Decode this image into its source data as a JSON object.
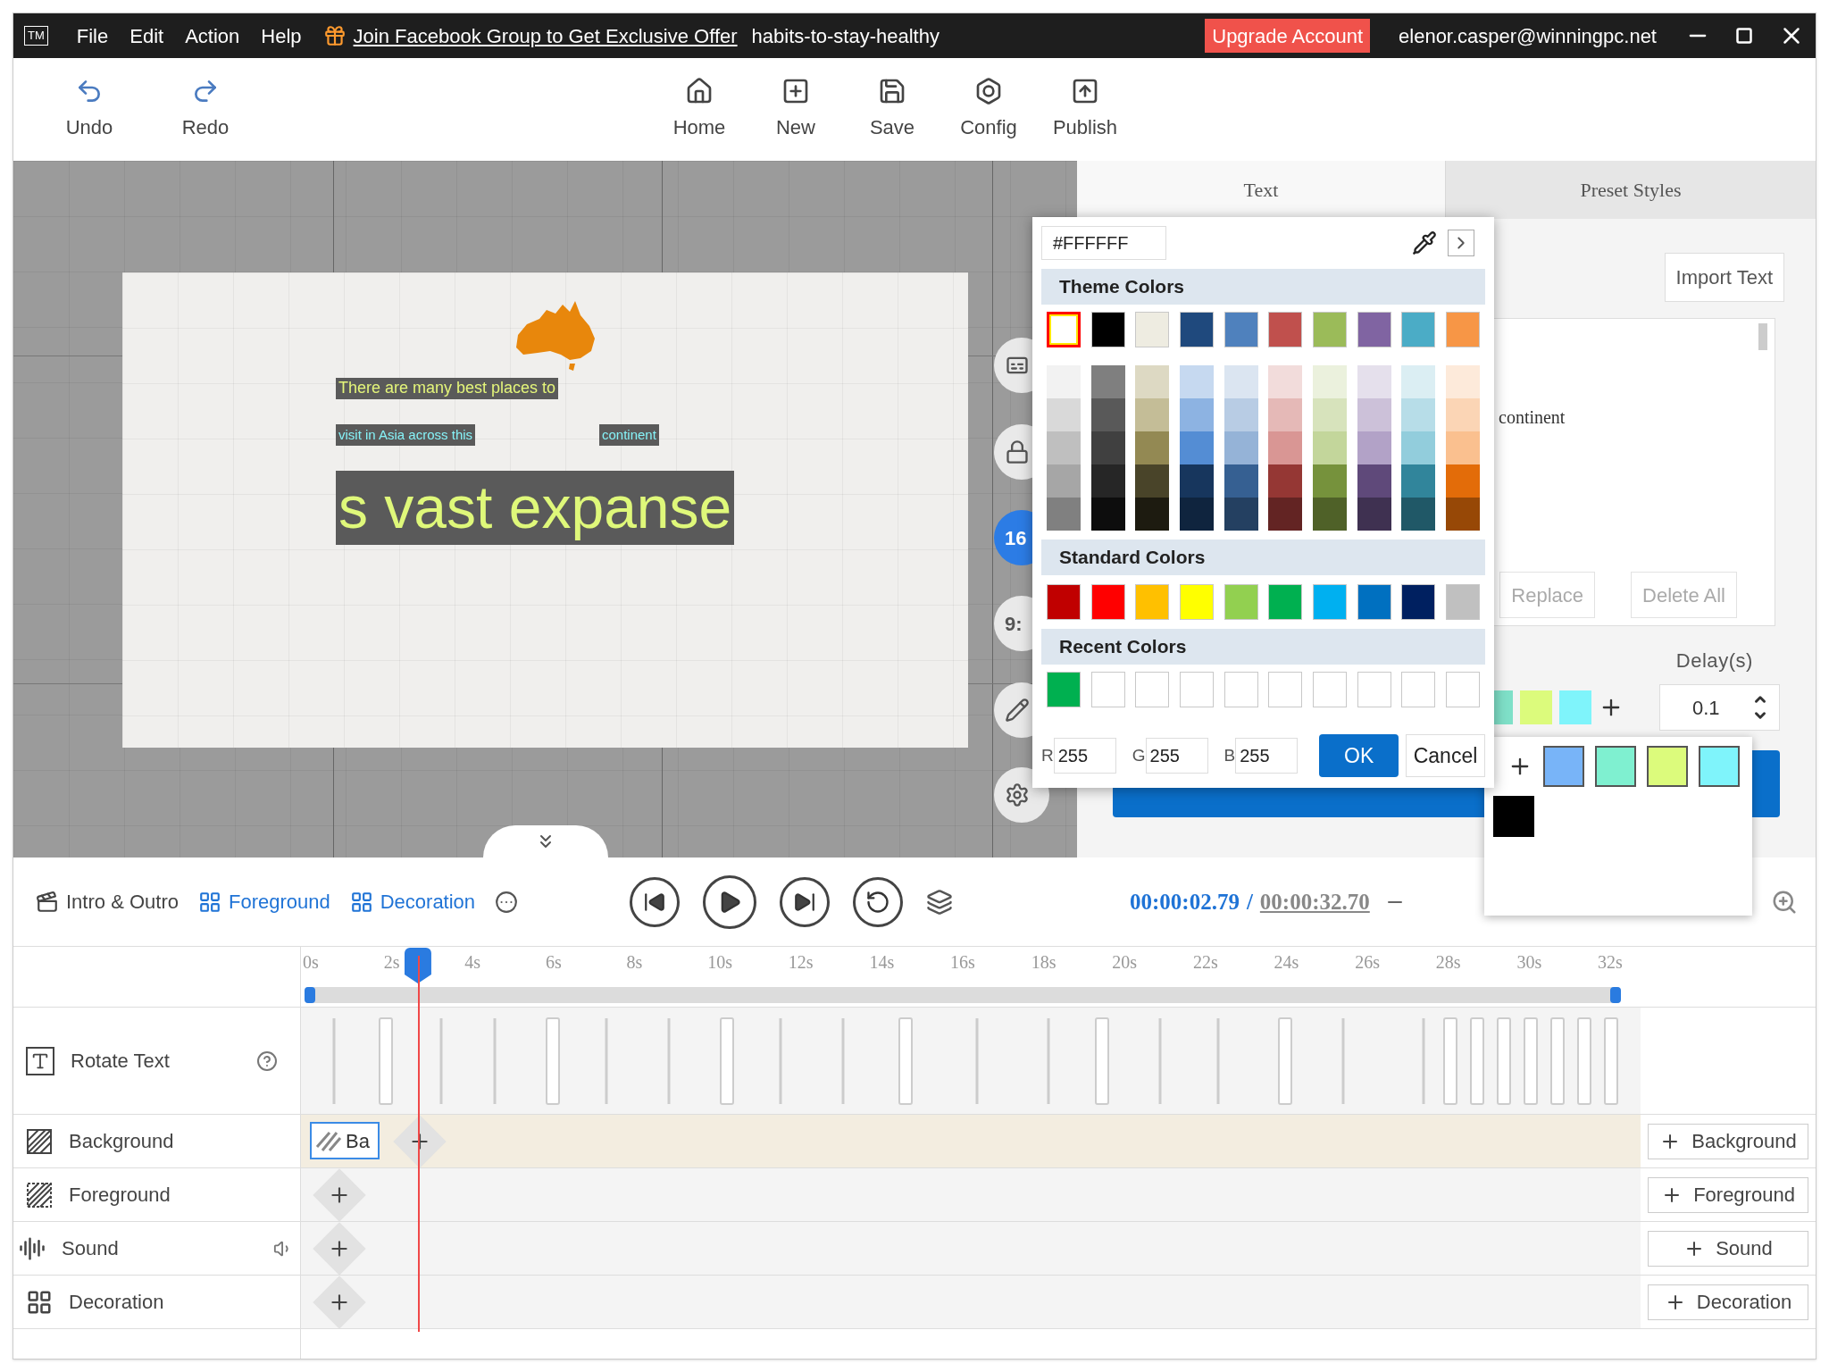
{
  "window": {
    "logo": "TM",
    "menu": [
      "File",
      "Edit",
      "Action",
      "Help"
    ],
    "promo_link": "Join Facebook Group to Get Exclusive Offer",
    "title": "habits-to-stay-healthy",
    "upgrade_button": "Upgrade Account",
    "user_email": "elenor.casper@winningpc.net"
  },
  "toolbar": {
    "left": [
      {
        "kind": "undo",
        "label": "Undo"
      },
      {
        "kind": "redo",
        "label": "Redo"
      }
    ],
    "center": [
      {
        "kind": "home",
        "label": "Home"
      },
      {
        "kind": "new",
        "label": "New"
      },
      {
        "kind": "save",
        "label": "Save"
      },
      {
        "kind": "config",
        "label": "Config"
      },
      {
        "kind": "publish",
        "label": "Publish"
      }
    ]
  },
  "canvas": {
    "texts": [
      {
        "text": "There are many best places to",
        "color": "#e4f57a"
      },
      {
        "text": "visit in Asia across this",
        "color": "#86f3f8"
      },
      {
        "text": "continent",
        "color": "#86f3f8"
      },
      {
        "text": "s vast expanse",
        "color": "#dff87a"
      }
    ],
    "side_buttons": [
      {
        "kind": "caption"
      },
      {
        "kind": "lock"
      },
      {
        "kind": "ratio",
        "label": "16",
        "selected": true
      },
      {
        "kind": "ratio",
        "label": "9:",
        "selected": false
      },
      {
        "kind": "edit"
      },
      {
        "kind": "settings"
      }
    ]
  },
  "panel": {
    "tabs": [
      {
        "label": "Text",
        "selected": true
      },
      {
        "label": "Preset Styles",
        "selected": false
      }
    ],
    "import_button": "Import Text",
    "text_area": "continent",
    "buttons": [
      {
        "label": "Replace",
        "disabled": true
      },
      {
        "label": "Delete All",
        "disabled": true
      }
    ],
    "delay_label": "Delay(s)",
    "delay_value": "0.1",
    "text_colors": [
      {
        "color": "#7fe0c8"
      },
      {
        "color": "#dcfb7c"
      },
      {
        "color": "#7ff4fb"
      }
    ]
  },
  "swatch_popover": {
    "swatches": [
      {
        "color": "#78b4f8"
      },
      {
        "color": "#7ff0d0"
      },
      {
        "color": "#dcfb7c"
      },
      {
        "color": "#7ff4fb"
      }
    ],
    "extra": {
      "color": "#000000"
    }
  },
  "color_picker": {
    "hex": "#FFFFFF",
    "theme_title": "Theme Colors",
    "theme": [
      {
        "color": "#ffffff",
        "selected": true
      },
      {
        "color": "#000000",
        "selected": false
      },
      {
        "color": "#eeece1",
        "selected": false
      },
      {
        "color": "#1f497d",
        "selected": false
      },
      {
        "color": "#4f81bd",
        "selected": false
      },
      {
        "color": "#c0504d",
        "selected": false
      },
      {
        "color": "#9bbb59",
        "selected": false
      },
      {
        "color": "#8064a2",
        "selected": false
      },
      {
        "color": "#4bacc6",
        "selected": false
      },
      {
        "color": "#f79646",
        "selected": false
      }
    ],
    "shade_columns": [
      {
        "shades": [
          {
            "color": "#f2f2f2"
          },
          {
            "color": "#d9d9d9"
          },
          {
            "color": "#bfbfbf"
          },
          {
            "color": "#a6a6a6"
          },
          {
            "color": "#808080"
          }
        ]
      },
      {
        "shades": [
          {
            "color": "#7f7f7f"
          },
          {
            "color": "#595959"
          },
          {
            "color": "#404040"
          },
          {
            "color": "#262626"
          },
          {
            "color": "#0d0d0d"
          }
        ]
      },
      {
        "shades": [
          {
            "color": "#ddd9c3"
          },
          {
            "color": "#c4bd97"
          },
          {
            "color": "#938953"
          },
          {
            "color": "#494429"
          },
          {
            "color": "#1d1b10"
          }
        ]
      },
      {
        "shades": [
          {
            "color": "#c6d9f0"
          },
          {
            "color": "#8db3e2"
          },
          {
            "color": "#548dd4"
          },
          {
            "color": "#17365d"
          },
          {
            "color": "#0f243e"
          }
        ]
      },
      {
        "shades": [
          {
            "color": "#dbe5f1"
          },
          {
            "color": "#b8cce4"
          },
          {
            "color": "#95b3d7"
          },
          {
            "color": "#366092"
          },
          {
            "color": "#244061"
          }
        ]
      },
      {
        "shades": [
          {
            "color": "#f2dcdb"
          },
          {
            "color": "#e5b9b7"
          },
          {
            "color": "#d99694"
          },
          {
            "color": "#953734"
          },
          {
            "color": "#632423"
          }
        ]
      },
      {
        "shades": [
          {
            "color": "#ebf1dd"
          },
          {
            "color": "#d7e3bc"
          },
          {
            "color": "#c3d69b"
          },
          {
            "color": "#76923c"
          },
          {
            "color": "#4f6128"
          }
        ]
      },
      {
        "shades": [
          {
            "color": "#e5e0ec"
          },
          {
            "color": "#ccc1d9"
          },
          {
            "color": "#b2a2c7"
          },
          {
            "color": "#5f497a"
          },
          {
            "color": "#3f3151"
          }
        ]
      },
      {
        "shades": [
          {
            "color": "#dbeef3"
          },
          {
            "color": "#b7dde8"
          },
          {
            "color": "#92cddc"
          },
          {
            "color": "#31859b"
          },
          {
            "color": "#205867"
          }
        ]
      },
      {
        "shades": [
          {
            "color": "#fdeada"
          },
          {
            "color": "#fbd5b5"
          },
          {
            "color": "#fac08f"
          },
          {
            "color": "#e36c09"
          },
          {
            "color": "#974806"
          }
        ]
      }
    ],
    "standard_title": "Standard Colors",
    "standard": [
      {
        "color": "#c00000"
      },
      {
        "color": "#ff0000"
      },
      {
        "color": "#ffc000"
      },
      {
        "color": "#ffff00"
      },
      {
        "color": "#92d050"
      },
      {
        "color": "#00b050"
      },
      {
        "color": "#00b0f0"
      },
      {
        "color": "#0070c0"
      },
      {
        "color": "#002060"
      },
      {
        "color": "#c0c0c0"
      }
    ],
    "recent_title": "Recent Colors",
    "recent": [
      {
        "color": "#00b050"
      },
      {
        "color": "#ffffff"
      },
      {
        "color": "#ffffff"
      },
      {
        "color": "#ffffff"
      },
      {
        "color": "#ffffff"
      },
      {
        "color": "#ffffff"
      },
      {
        "color": "#ffffff"
      },
      {
        "color": "#ffffff"
      },
      {
        "color": "#ffffff"
      },
      {
        "color": "#ffffff"
      }
    ],
    "channels": [
      {
        "label": "R",
        "value": "255"
      },
      {
        "label": "G",
        "value": "255"
      },
      {
        "label": "B",
        "value": "255"
      }
    ],
    "ok": "OK",
    "cancel": "Cancel"
  },
  "timeline": {
    "tabs": [
      {
        "kind": "intro",
        "label": "Intro & Outro",
        "selected": false
      },
      {
        "kind": "foreground",
        "label": "Foreground",
        "selected": true
      },
      {
        "kind": "decoration",
        "label": "Decoration",
        "selected": true
      }
    ],
    "current_time": "00:00:02.79",
    "separator": "/",
    "total_time": "00:00:32.70",
    "ruler": [
      "0s",
      "2s",
      "4s",
      "6s",
      "8s",
      "10s",
      "12s",
      "14s",
      "16s",
      "18s",
      "20s",
      "22s",
      "24s",
      "26s",
      "28s",
      "30s",
      "32s"
    ],
    "playhead": {
      "level": 0.085
    },
    "tracks": [
      {
        "kind": "text",
        "label": "Rotate Text"
      },
      {
        "kind": "background",
        "label": "Background",
        "clip": "Ba",
        "add_button": "Background"
      },
      {
        "kind": "foreground",
        "label": "Foreground",
        "add_button": "Foreground"
      },
      {
        "kind": "sound",
        "label": "Sound",
        "add_button": "Sound"
      },
      {
        "kind": "decoration",
        "label": "Decoration",
        "add_button": "Decoration"
      }
    ]
  }
}
